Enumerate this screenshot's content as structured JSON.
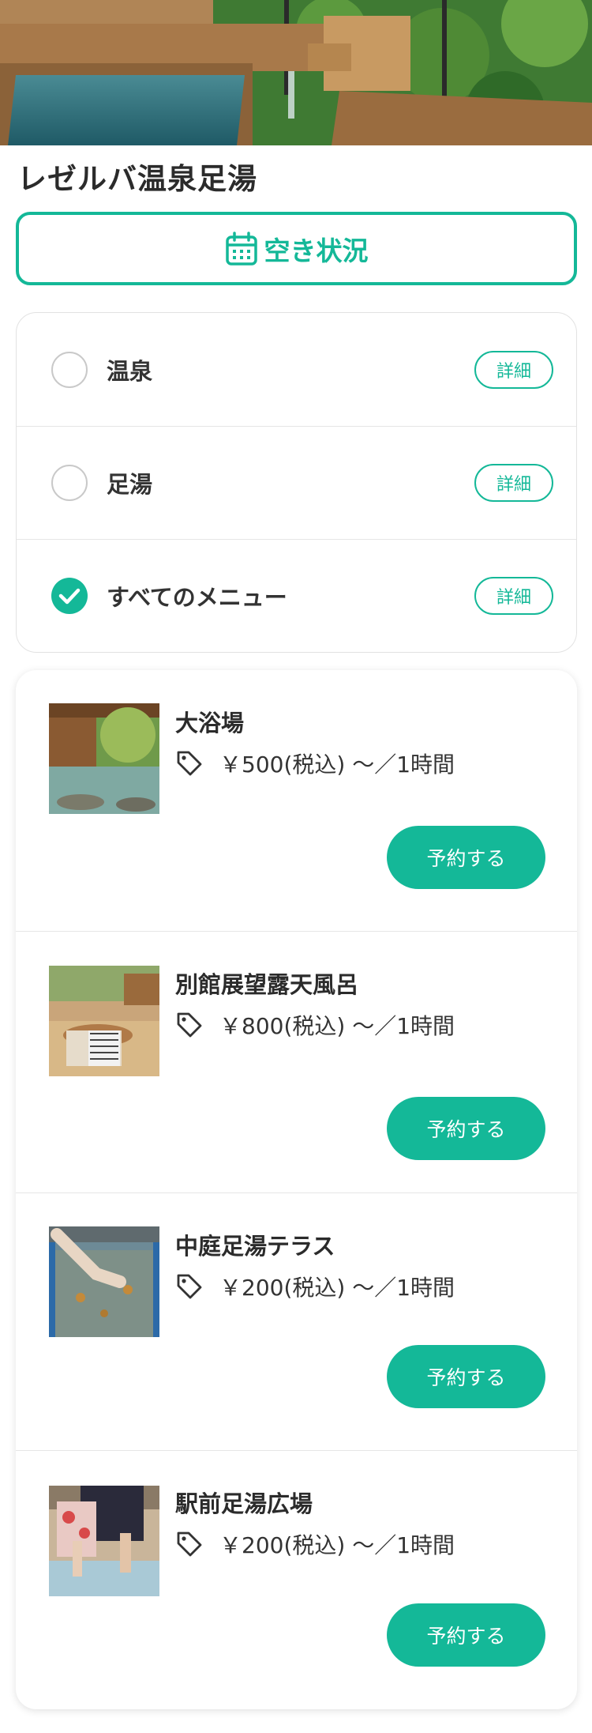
{
  "page": {
    "title": "レゼルバ温泉足湯"
  },
  "availability": {
    "label": "空き状況",
    "icon": "calendar-icon"
  },
  "filters": [
    {
      "label": "温泉",
      "detail_label": "詳細",
      "checked": false
    },
    {
      "label": "足湯",
      "detail_label": "詳細",
      "checked": false
    },
    {
      "label": "すべてのメニュー",
      "detail_label": "詳細",
      "checked": true
    }
  ],
  "menu_items": [
    {
      "name": "大浴場",
      "price": "￥500(税込) 〜／1時間",
      "reserve_label": "予約する"
    },
    {
      "name": "別館展望露天風呂",
      "price": "￥800(税込) 〜／1時間",
      "reserve_label": "予約する"
    },
    {
      "name": "中庭足湯テラス",
      "price": "￥200(税込) 〜／1時間",
      "reserve_label": "予約する"
    },
    {
      "name": "駅前足湯広場",
      "price": "￥200(税込) 〜／1時間",
      "reserve_label": "予約する"
    }
  ],
  "colors": {
    "accent": "#14b898",
    "text": "#333333",
    "border": "#e2e2e2"
  }
}
